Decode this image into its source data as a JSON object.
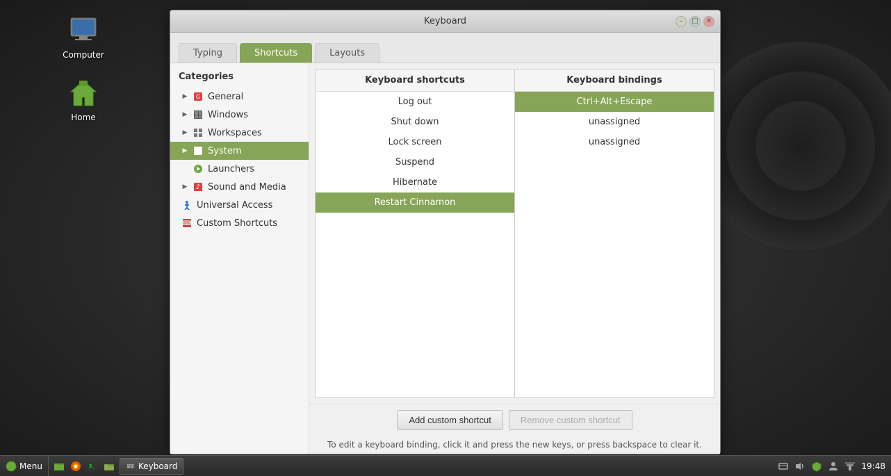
{
  "desktop": {
    "icons": [
      {
        "id": "computer",
        "label": "Computer",
        "type": "monitor"
      },
      {
        "id": "home",
        "label": "Home",
        "type": "folder-green"
      }
    ]
  },
  "taskbar": {
    "menu_label": "Menu",
    "time": "19:48",
    "window_label": "Keyboard"
  },
  "window": {
    "title": "Keyboard",
    "tabs": [
      {
        "id": "typing",
        "label": "Typing",
        "active": false
      },
      {
        "id": "shortcuts",
        "label": "Shortcuts",
        "active": true
      },
      {
        "id": "layouts",
        "label": "Layouts",
        "active": false
      }
    ]
  },
  "categories": {
    "header": "Categories",
    "items": [
      {
        "id": "general",
        "label": "General",
        "expanded": false,
        "active": false
      },
      {
        "id": "windows",
        "label": "Windows",
        "expanded": false,
        "active": false
      },
      {
        "id": "workspaces",
        "label": "Workspaces",
        "expanded": false,
        "active": false
      },
      {
        "id": "system",
        "label": "System",
        "expanded": true,
        "active": true
      },
      {
        "id": "launchers",
        "label": "Launchers",
        "expanded": false,
        "active": false,
        "indent": true
      },
      {
        "id": "sound-media",
        "label": "Sound and Media",
        "expanded": false,
        "active": false
      },
      {
        "id": "universal-access",
        "label": "Universal Access",
        "expanded": false,
        "active": false
      },
      {
        "id": "custom-shortcuts",
        "label": "Custom Shortcuts",
        "expanded": false,
        "active": false
      }
    ]
  },
  "shortcuts": {
    "header": "Keyboard shortcuts",
    "items": [
      {
        "id": "log-out",
        "label": "Log out",
        "selected": false
      },
      {
        "id": "shut-down",
        "label": "Shut down",
        "selected": false
      },
      {
        "id": "lock-screen",
        "label": "Lock screen",
        "selected": false
      },
      {
        "id": "suspend",
        "label": "Suspend",
        "selected": false
      },
      {
        "id": "hibernate",
        "label": "Hibernate",
        "selected": false
      },
      {
        "id": "restart-cinnamon",
        "label": "Restart Cinnamon",
        "selected": true
      }
    ]
  },
  "bindings": {
    "header": "Keyboard bindings",
    "items": [
      {
        "id": "binding-1",
        "label": "Ctrl+Alt+Escape",
        "selected": true
      },
      {
        "id": "binding-2",
        "label": "unassigned",
        "selected": false
      },
      {
        "id": "binding-3",
        "label": "unassigned",
        "selected": false
      }
    ]
  },
  "buttons": {
    "add_label": "Add custom shortcut",
    "remove_label": "Remove custom shortcut"
  },
  "hint": "To edit a keyboard binding, click it and press the new keys, or press backspace to clear it."
}
